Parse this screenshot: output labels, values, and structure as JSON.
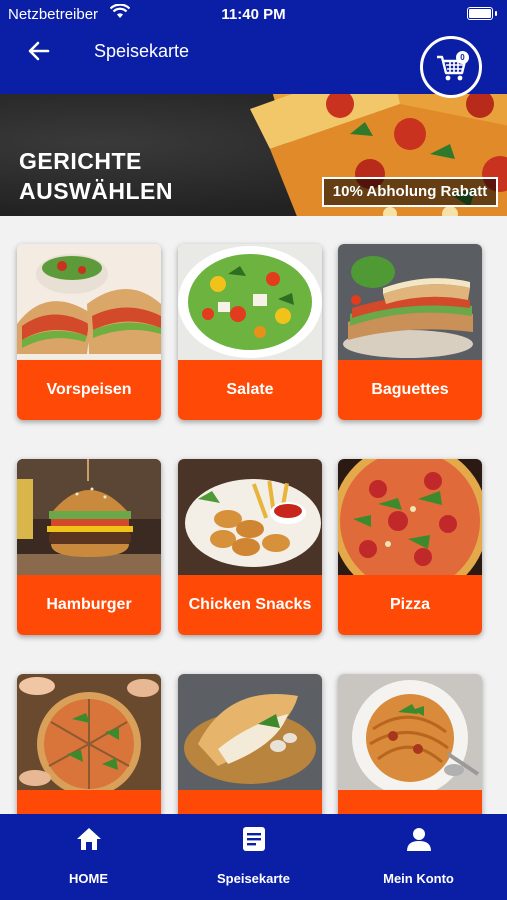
{
  "status_bar": {
    "carrier": "Netzbetreiber",
    "time": "11:40 PM"
  },
  "header": {
    "title": "Speisekarte",
    "cart_count": "0"
  },
  "banner": {
    "heading_line1": "GERICHTE",
    "heading_line2": "AUSWÄHLEN",
    "promo": "10% Abholung Rabatt"
  },
  "categories": [
    {
      "label": "Vorspeisen"
    },
    {
      "label": "Salate"
    },
    {
      "label": "Baguettes"
    },
    {
      "label": "Hamburger"
    },
    {
      "label": "Chicken Snacks"
    },
    {
      "label": "Pizza"
    },
    {
      "label": ""
    },
    {
      "label": ""
    },
    {
      "label": ""
    }
  ],
  "bottom_nav": [
    {
      "label": "HOME",
      "icon": "home-icon"
    },
    {
      "label": "Speisekarte",
      "icon": "menu-book-icon"
    },
    {
      "label": "Mein Konto",
      "icon": "person-icon"
    }
  ],
  "colors": {
    "primary": "#0b1fa6",
    "accent": "#ff4a07"
  }
}
